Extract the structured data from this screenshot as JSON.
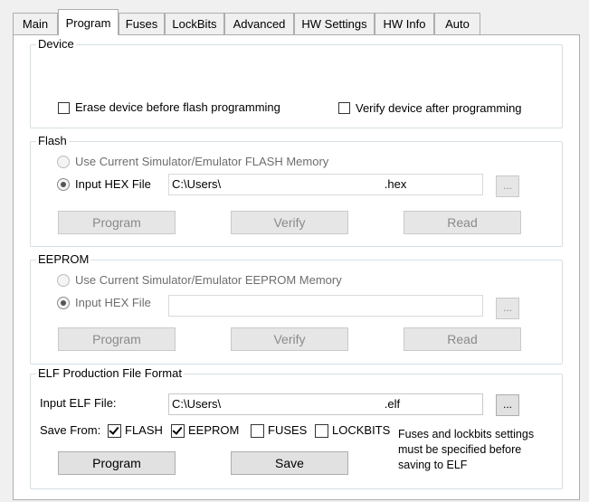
{
  "tabs": [
    {
      "label": "Main"
    },
    {
      "label": "Program"
    },
    {
      "label": "Fuses"
    },
    {
      "label": "LockBits"
    },
    {
      "label": "Advanced"
    },
    {
      "label": "HW Settings"
    },
    {
      "label": "HW Info"
    },
    {
      "label": "Auto"
    }
  ],
  "active_tab": "Program",
  "device": {
    "legend": "Device",
    "erase_label": "Erase device before flash programming",
    "erase_checked": false,
    "verify_label": "Verify device after programming",
    "verify_checked": false
  },
  "flash": {
    "legend": "Flash",
    "use_simulator_label": "Use Current Simulator/Emulator FLASH Memory",
    "input_hex_label": "Input HEX File",
    "path_value": "C:\\Users\\                                                  .hex",
    "browse_label": "...",
    "program_label": "Program",
    "verify_label": "Verify",
    "read_label": "Read"
  },
  "eeprom": {
    "legend": "EEPROM",
    "use_simulator_label": "Use Current Simulator/Emulator EEPROM Memory",
    "input_hex_label": "Input HEX File",
    "path_value": "",
    "browse_label": "...",
    "program_label": "Program",
    "verify_label": "Verify",
    "read_label": "Read"
  },
  "elf": {
    "legend": "ELF Production File Format",
    "input_label": "Input ELF File:",
    "path_value": "C:\\Users\\                                                  .elf",
    "browse_label": "...",
    "save_from_label": "Save From:",
    "flash_label": "FLASH",
    "flash_checked": true,
    "eeprom_label": "EEPROM",
    "eeprom_checked": true,
    "fuses_label": "FUSES",
    "fuses_checked": false,
    "lockbits_label": "LOCKBITS",
    "lockbits_checked": false,
    "note_line1": "Fuses and lockbits settings",
    "note_line2": "must be specified before",
    "note_line3": "saving to ELF",
    "program_label": "Program",
    "save_label": "Save"
  }
}
